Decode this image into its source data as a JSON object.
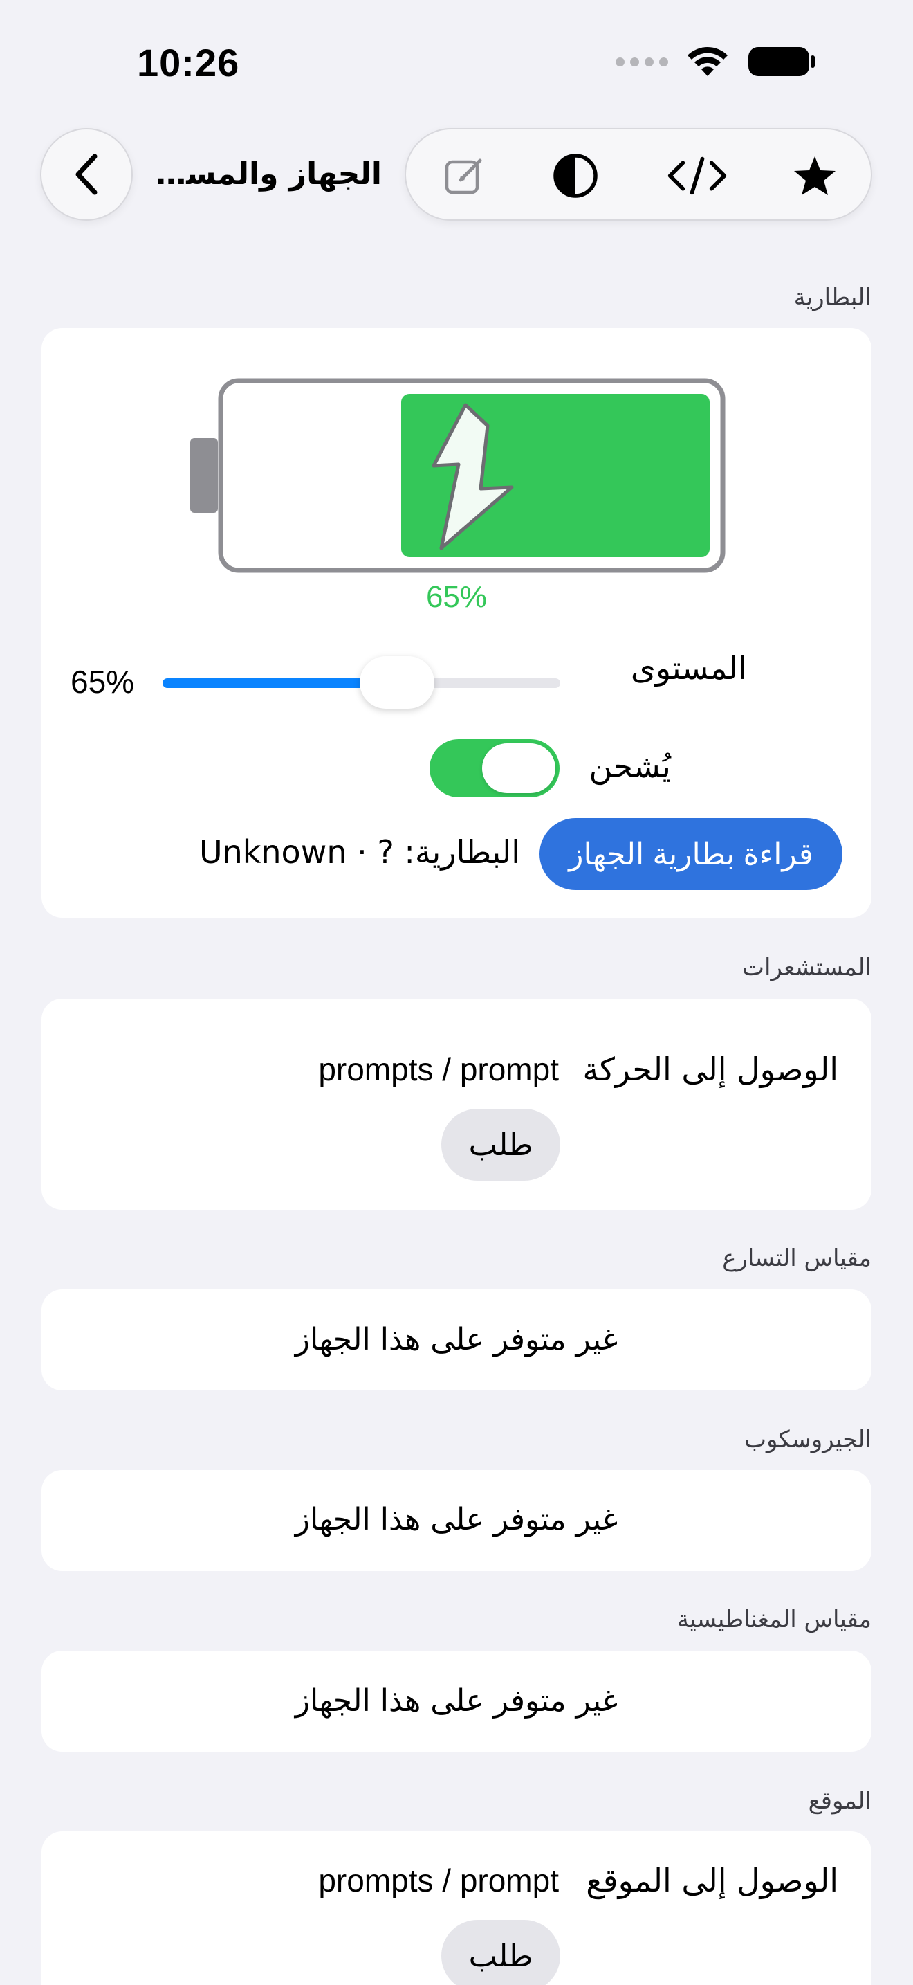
{
  "status_bar": {
    "time": "10:26"
  },
  "nav": {
    "title": "الجهاز والمستشعرات"
  },
  "battery": {
    "section_label": "البطارية",
    "level_percent": 65,
    "level_text": "65%",
    "level_label": "المستوى",
    "slider_value_text": "65%",
    "charging_label": "يُشحن",
    "charging": true,
    "read_button": "قراءة بطارية الجهاز",
    "readout": "البطارية: ? · Unknown",
    "colors": {
      "fill": "#34c759",
      "level_text": "#34c759"
    }
  },
  "sensors": {
    "section_label": "المستشعرات",
    "motion_label": "الوصول إلى الحركة",
    "motion_value": "prompts / prompt",
    "request_button": "طلب"
  },
  "accelerometer": {
    "section_label": "مقياس التسارع",
    "message": "غير متوفر على هذا الجهاز"
  },
  "gyroscope": {
    "section_label": "الجيروسكوب",
    "message": "غير متوفر على هذا الجهاز"
  },
  "magnetometer": {
    "section_label": "مقياس المغناطيسية",
    "message": "غير متوفر على هذا الجهاز"
  },
  "location": {
    "section_label": "الموقع",
    "access_label": "الوصول إلى الموقع",
    "access_value": "prompts / prompt",
    "request_button": "طلب"
  },
  "icons": {
    "back": "chevron-left-icon",
    "edit": "pencil-square-icon",
    "theme": "contrast-icon",
    "code": "code-icon",
    "favorite": "star-icon"
  }
}
